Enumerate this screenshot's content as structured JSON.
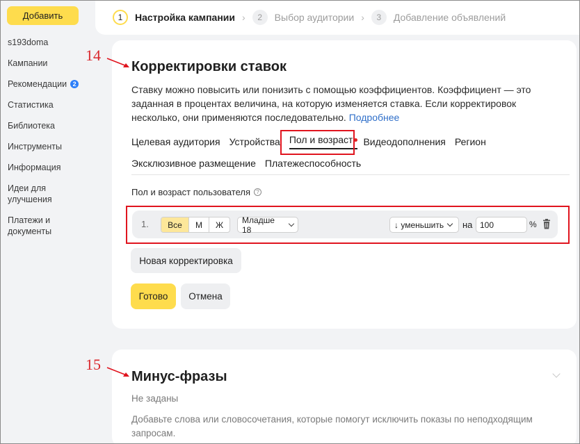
{
  "sidebar": {
    "add_button": "Добавить",
    "login": "s193doma",
    "items": [
      {
        "label": "Кампании"
      },
      {
        "label": "Рекомендации",
        "badge": "2"
      },
      {
        "label": "Статистика"
      },
      {
        "label": "Библиотека"
      },
      {
        "label": "Инструменты"
      },
      {
        "label": "Информация"
      },
      {
        "label": "Идеи для улучшения"
      },
      {
        "label": "Платежи и документы"
      }
    ]
  },
  "steps": [
    {
      "num": "1",
      "label": "Настройка кампании",
      "active": true
    },
    {
      "num": "2",
      "label": "Выбор аудитории",
      "active": false
    },
    {
      "num": "3",
      "label": "Добавление объявлений",
      "active": false
    }
  ],
  "bid_adjustments": {
    "title": "Корректировки ставок",
    "description": "Ставку можно повысить или понизить с помощью коэффициентов. Коэффициент — это заданная в процентах величина, на которую изменяется ставка. Если корректировок несколько, они применяются последовательно.",
    "more_link": "Подробнее",
    "tabs_row1": [
      "Целевая аудитория",
      "Устройства",
      "Пол и возраст",
      "Видеодополнения",
      "Регион"
    ],
    "tabs_row2": [
      "Эксклюзивное размещение",
      "Платежеспособность"
    ],
    "active_tab": "Пол и возраст",
    "section_label": "Пол и возраст пользователя",
    "row": {
      "index": "1.",
      "gender_options": [
        "Все",
        "М",
        "Ж"
      ],
      "gender_selected": "Все",
      "age": "Младше 18",
      "direction": "↓ уменьшить",
      "on_label": "на",
      "value": "100",
      "unit": "%"
    },
    "new_button": "Новая корректировка",
    "done_button": "Готово",
    "cancel_button": "Отмена"
  },
  "negative_keywords": {
    "title": "Минус-фразы",
    "status": "Не заданы",
    "description": "Добавьте слова или словосочетания, которые помогут исключить показы по неподходящим запросам."
  },
  "annotations": {
    "label_14": "14",
    "label_15": "15",
    "color": "#e0141e"
  }
}
